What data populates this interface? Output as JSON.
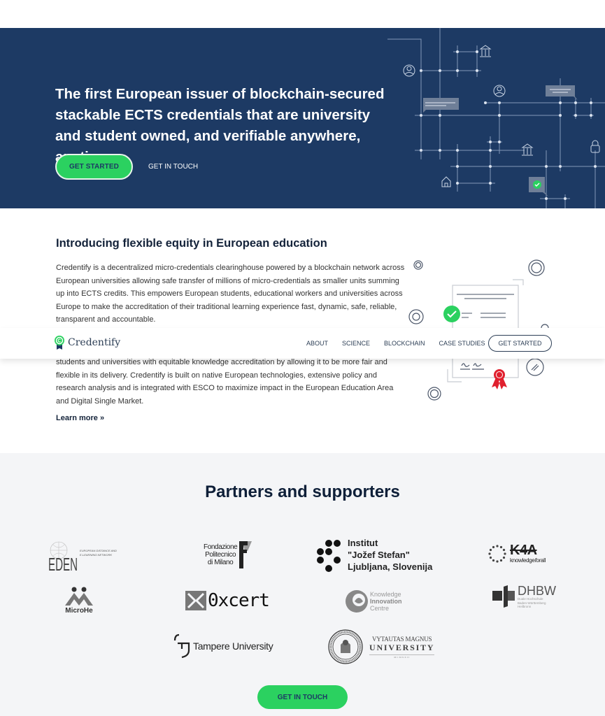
{
  "hero": {
    "title": "The first European issuer of blockchain-secured stackable ECTS credentials that are university and student owned, and verifiable anywhere, anytime.",
    "primary_button": "GET STARTED",
    "secondary_link": "GET IN TOUCH",
    "colors": {
      "background": "#1d3a64",
      "accent": "#2bd160"
    }
  },
  "intro": {
    "heading": "Introducing flexible equity in European education",
    "paragraph1": "Credentify is a decentralized micro-credentials clearinghouse powered by a blockchain network across European universities allowing safe transfer of millions of micro-credentials as smaller units summing up into ECTS credits. This empowers European students, educational workers and universities across Europe to make the accreditation of their traditional learning experience fast, dynamic, safe, reliable, transparent and accountable.",
    "paragraph2": "students and universities with equitable knowledge accreditation by allowing it to be more fair and flexible in its delivery. Credentify is built on native European technologies, extensive policy and research analysis and is integrated with ESCO to maximize impact in the European Education Area and Digital Single Market.",
    "learn_more": "Learn more »"
  },
  "navbar": {
    "brand": "Credentify",
    "links": [
      "ABOUT",
      "SCIENCE",
      "BLOCKCHAIN",
      "CASE STUDIES"
    ],
    "cta": "GET STARTED"
  },
  "partners": {
    "heading": "Partners and supporters",
    "logos": {
      "eden": {
        "name": "EDEN",
        "sub1": "EUROPEAN DISTANCE AND",
        "sub2": "E-LEARNING NETWORK"
      },
      "polimi": {
        "line1": "Fondazione",
        "line2": "Politecnico",
        "line3": "di Milano"
      },
      "ijs": {
        "line1": "Institut",
        "line2": "\"Jožef Stefan\"",
        "line3": "Ljubljana, Slovenija"
      },
      "k4a": {
        "name": "K4A",
        "tagline_a": "knowledge",
        "tagline_b": "for",
        "tagline_c": "all"
      },
      "microhe": {
        "name": "MicroHe"
      },
      "oxcert": {
        "name": "0xcert"
      },
      "kic": {
        "line1": "Knowledge",
        "line2": "Innovation",
        "line3": "Centre"
      },
      "dhbw": {
        "name": "DHBW",
        "sub1": "Duale Hochschule",
        "sub2": "Baden-Württemberg",
        "sub3": "Heilbronn"
      },
      "tampere": {
        "name": "Tampere University"
      },
      "vmu": {
        "line1": "VYTAUTAS MAGNUS",
        "line2": "UNIVERSITY",
        "line3": "MCMXXII"
      }
    },
    "cta": "GET IN TOUCH"
  }
}
